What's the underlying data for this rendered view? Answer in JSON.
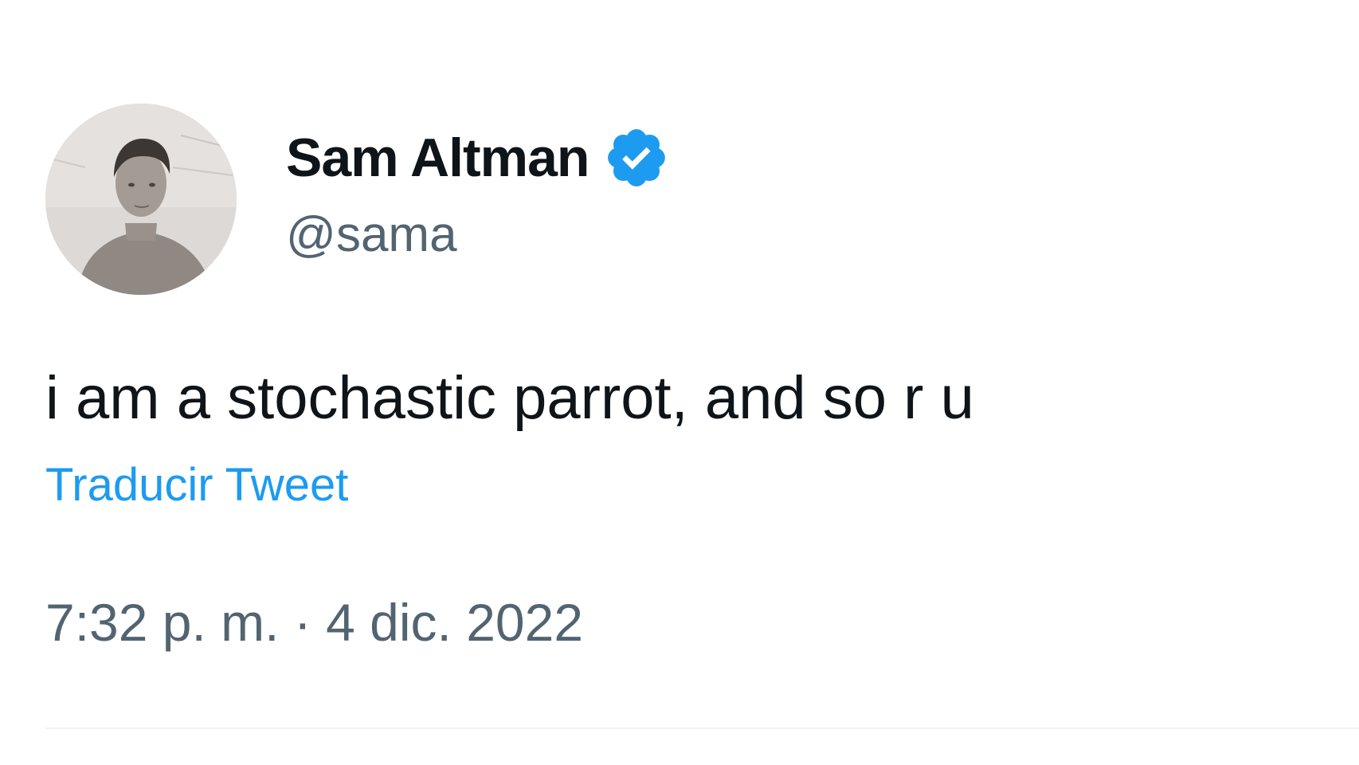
{
  "tweet": {
    "author": {
      "display_name": "Sam Altman",
      "handle": "@sama",
      "verified": true,
      "verified_badge_icon": "verified-badge-icon",
      "avatar_icon": "profile-photo"
    },
    "text": "i am a stochastic parrot, and so r u",
    "translate_label": "Traducir Tweet",
    "timestamp": "7:32 p. m. · 4 dic. 2022"
  },
  "colors": {
    "text_primary": "#0f1419",
    "text_secondary": "#536471",
    "link_blue": "#1d9bf0",
    "verified_blue": "#1d9bf0",
    "divider": "#eff3f4",
    "background": "#ffffff"
  }
}
